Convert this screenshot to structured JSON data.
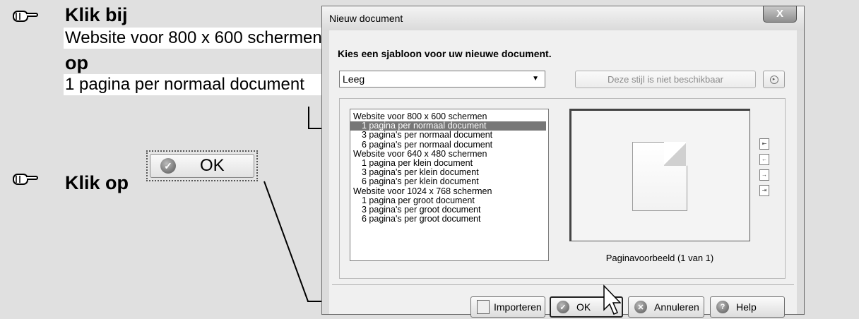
{
  "instructions": {
    "step1": {
      "heading1": "Klik bij",
      "value1": "Website voor 800 x 600 schermen",
      "heading2": "op",
      "value2": "1 pagina per normaal document"
    },
    "step2": {
      "heading": "Klik op",
      "button_label": "OK"
    }
  },
  "dialog": {
    "title": "Nieuw document",
    "close_label": "X",
    "prompt": "Kies een sjabloon voor uw nieuwe document.",
    "style_select": {
      "value": "Leeg"
    },
    "style_button": "Deze stijl is niet beschikbaar",
    "templates": [
      {
        "label": "Website voor 800 x 600 schermen",
        "level": "group",
        "selected": false
      },
      {
        "label": "1 pagina per normaal document",
        "level": "item",
        "selected": true
      },
      {
        "label": "3 pagina's per normaal document",
        "level": "item",
        "selected": false
      },
      {
        "label": "6 pagina's per normaal document",
        "level": "item",
        "selected": false
      },
      {
        "label": "Website voor 640 x 480 schermen",
        "level": "group",
        "selected": false
      },
      {
        "label": "1 pagina per klein document",
        "level": "item",
        "selected": false
      },
      {
        "label": "3 pagina's per klein document",
        "level": "item",
        "selected": false
      },
      {
        "label": "6 pagina's per klein document",
        "level": "item",
        "selected": false
      },
      {
        "label": "Website voor 1024 x 768 schermen",
        "level": "group",
        "selected": false
      },
      {
        "label": "1 pagina per groot document",
        "level": "item",
        "selected": false
      },
      {
        "label": "3 pagina's per groot document",
        "level": "item",
        "selected": false
      },
      {
        "label": "6 pagina's per groot document",
        "level": "item",
        "selected": false
      }
    ],
    "preview_caption": "Paginavoorbeeld (1 van 1)",
    "buttons": {
      "import": "Importeren",
      "ok": "OK",
      "cancel": "Annuleren",
      "help": "Help"
    }
  }
}
